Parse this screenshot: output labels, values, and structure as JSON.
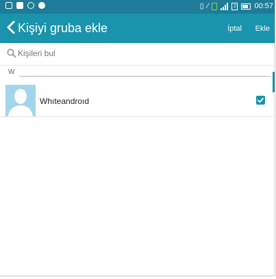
{
  "status_bar": {
    "time": "00:57",
    "sim_label": "2",
    "icons": [
      "calendar-icon",
      "message-icon",
      "chat-icon",
      "app-icon",
      "vibrate-icon",
      "nfc-icon",
      "battery-charging-icon",
      "signal-icon",
      "sim-icon",
      "battery-icon"
    ]
  },
  "header": {
    "title": "Kişiyi gruba ekle",
    "cancel_label": "İptal",
    "add_label": "Ekle"
  },
  "search": {
    "placeholder": "Kişileri bul"
  },
  "section": {
    "letter": "W"
  },
  "contacts": [
    {
      "name": "Whıteandroıd",
      "checked": true
    }
  ],
  "colors": {
    "status_bar": "#1e7c98",
    "app_bar": "#1a94ad",
    "avatar_bg": "#a3d5ea"
  }
}
